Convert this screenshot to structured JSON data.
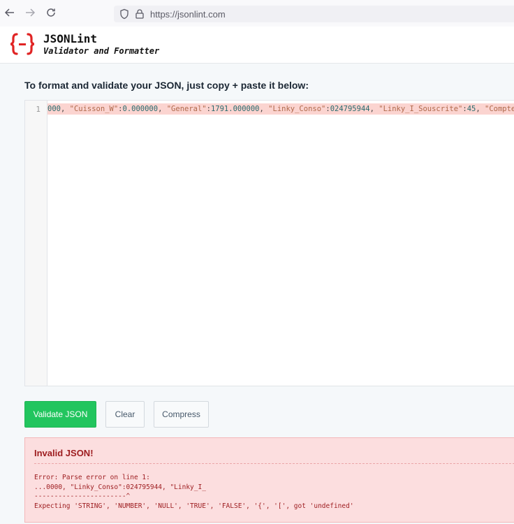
{
  "browser": {
    "url": "https://jsonlint.com",
    "icons": [
      "back-arrow-icon",
      "forward-arrow-icon",
      "reload-icon",
      "shield-icon",
      "lock-icon"
    ]
  },
  "header": {
    "title": "JSONLint",
    "subtitle": "Validator and Formatter",
    "logo_color": "#e02424"
  },
  "instructions": "To format and validate your JSON, just copy + paste it below:",
  "editor": {
    "line_number": "1",
    "code_tokens": [
      {
        "t": "num",
        "v": "000"
      },
      {
        "t": "plain",
        "v": ", "
      },
      {
        "t": "str",
        "v": "\"Cuisson_W\""
      },
      {
        "t": "plain",
        "v": ":"
      },
      {
        "t": "num",
        "v": "0.000000"
      },
      {
        "t": "plain",
        "v": ", "
      },
      {
        "t": "str",
        "v": "\"General\""
      },
      {
        "t": "plain",
        "v": ":"
      },
      {
        "t": "num",
        "v": "1791.000000"
      },
      {
        "t": "plain",
        "v": ", "
      },
      {
        "t": "str",
        "v": "\"Linky_Conso\""
      },
      {
        "t": "plain",
        "v": ":"
      },
      {
        "t": "num",
        "v": "024795944"
      },
      {
        "t": "plain",
        "v": ", "
      },
      {
        "t": "str",
        "v": "\"Linky_I_Souscrite\""
      },
      {
        "t": "plain",
        "v": ":"
      },
      {
        "t": "num",
        "v": "45"
      },
      {
        "t": "plain",
        "v": ", "
      },
      {
        "t": "str",
        "v": "\"Compteu"
      }
    ],
    "error_line_color": "#fbd4d0"
  },
  "buttons": {
    "validate": "Validate JSON",
    "clear": "Clear",
    "compress": "Compress"
  },
  "error": {
    "title": "Invalid JSON!",
    "message": "Error: Parse error on line 1:\n...0000, \"Linky_Conso\":024795944, \"Linky_I_\n-----------------------^\nExpecting 'STRING', 'NUMBER', 'NULL', 'TRUE', 'FALSE', '{', '[', got 'undefined'"
  },
  "colors": {
    "validate_button": "#22c55e",
    "error_bg": "#fcdedf",
    "error_text": "#9d1c1f"
  }
}
